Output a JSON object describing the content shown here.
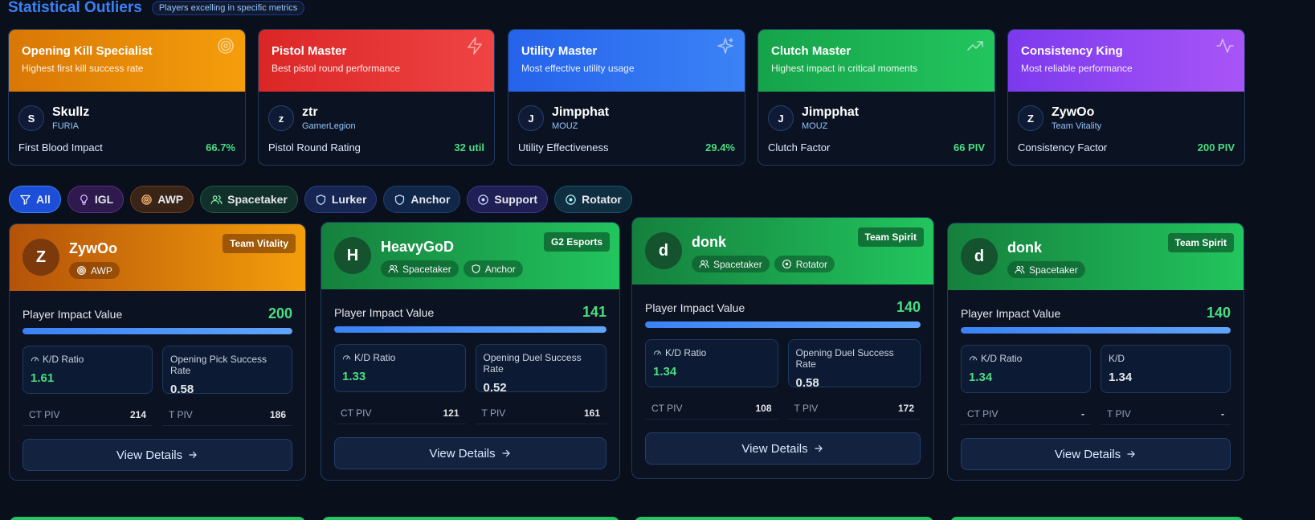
{
  "header": {
    "title": "Statistical Outliers",
    "subtitle": "Players excelling in specific metrics"
  },
  "outliers": [
    {
      "title": "Opening Kill Specialist",
      "desc": "Highest first kill success rate",
      "icon": "target-icon",
      "initial": "S",
      "player": "Skullz",
      "team": "FURIA",
      "metric": "First Blood Impact",
      "value": "66.7%",
      "gradient": [
        "#d97706",
        "#f59e0b"
      ]
    },
    {
      "title": "Pistol Master",
      "desc": "Best pistol round performance",
      "icon": "zap-icon",
      "initial": "z",
      "player": "ztr",
      "team": "GamerLegion",
      "metric": "Pistol Round Rating",
      "value": "32 util",
      "gradient": [
        "#dc2626",
        "#ef4444"
      ]
    },
    {
      "title": "Utility Master",
      "desc": "Most effective utility usage",
      "icon": "sparkles-icon",
      "initial": "J",
      "player": "Jimpphat",
      "team": "MOUZ",
      "metric": "Utility Effectiveness",
      "value": "29.4%",
      "gradient": [
        "#2563eb",
        "#3b82f6"
      ]
    },
    {
      "title": "Clutch Master",
      "desc": "Highest impact in critical moments",
      "icon": "trending-up-icon",
      "initial": "J",
      "player": "Jimpphat",
      "team": "MOUZ",
      "metric": "Clutch Factor",
      "value": "66 PIV",
      "gradient": [
        "#16a34a",
        "#22c55e"
      ]
    },
    {
      "title": "Consistency King",
      "desc": "Most reliable performance",
      "icon": "activity-icon",
      "initial": "Z",
      "player": "ZywOo",
      "team": "Team Vitality",
      "metric": "Consistency Factor",
      "value": "200 PIV",
      "gradient": [
        "#7c3aed",
        "#a855f7"
      ]
    }
  ],
  "filters": [
    {
      "label": "All",
      "icon": "filter-icon",
      "active": true
    },
    {
      "label": "IGL",
      "icon": "lightbulb-icon"
    },
    {
      "label": "AWP",
      "icon": "target-icon"
    },
    {
      "label": "Spacetaker",
      "icon": "users-icon"
    },
    {
      "label": "Lurker",
      "icon": "shield-icon"
    },
    {
      "label": "Anchor",
      "icon": "shield-icon"
    },
    {
      "label": "Support",
      "icon": "circle-dot-icon"
    },
    {
      "label": "Rotator",
      "icon": "circle-dot-icon"
    }
  ],
  "players": [
    {
      "initial": "Z",
      "name": "ZywOo",
      "team": "Team Vitality",
      "roles": [
        {
          "label": "AWP",
          "icon": "target-icon"
        }
      ],
      "piv_label": "Player Impact Value",
      "piv": "200",
      "piv_fraction": 1.0,
      "stat1_label": "K/D Ratio",
      "stat1_value": "1.61",
      "stat2_label": "Opening Pick Success Rate",
      "stat2_value": "0.58",
      "ct_label": "CT PIV",
      "ct_value": "214",
      "t_label": "T PIV",
      "t_value": "186",
      "button": "View Details",
      "theme": "orange"
    },
    {
      "initial": "H",
      "name": "HeavyGoD",
      "team": "G2 Esports",
      "roles": [
        {
          "label": "Spacetaker",
          "icon": "users-icon"
        },
        {
          "label": "Anchor",
          "icon": "shield-icon"
        }
      ],
      "piv_label": "Player Impact Value",
      "piv": "141",
      "piv_fraction": 1.0,
      "stat1_label": "K/D Ratio",
      "stat1_value": "1.33",
      "stat2_label": "Opening Duel Success Rate",
      "stat2_value": "0.52",
      "ct_label": "CT PIV",
      "ct_value": "121",
      "t_label": "T PIV",
      "t_value": "161",
      "button": "View Details",
      "theme": "green"
    },
    {
      "initial": "d",
      "name": "donk",
      "team": "Team Spirit",
      "roles": [
        {
          "label": "Spacetaker",
          "icon": "users-icon"
        },
        {
          "label": "Rotator",
          "icon": "circle-dot-icon"
        }
      ],
      "piv_label": "Player Impact Value",
      "piv": "140",
      "piv_fraction": 1.0,
      "stat1_label": "K/D Ratio",
      "stat1_value": "1.34",
      "stat2_label": "Opening Duel Success Rate",
      "stat2_value": "0.58",
      "ct_label": "CT PIV",
      "ct_value": "108",
      "t_label": "T PIV",
      "t_value": "172",
      "button": "View Details",
      "theme": "green"
    },
    {
      "initial": "d",
      "name": "donk",
      "team": "Team Spirit",
      "roles": [
        {
          "label": "Spacetaker",
          "icon": "users-icon"
        }
      ],
      "piv_label": "Player Impact Value",
      "piv": "140",
      "piv_fraction": 1.0,
      "stat1_label": "K/D Ratio",
      "stat1_value": "1.34",
      "stat2_label": "K/D",
      "stat2_value": "1.34",
      "ct_label": "CT PIV",
      "ct_value": "-",
      "t_label": "T PIV",
      "t_value": "-",
      "button": "View Details",
      "theme": "green"
    }
  ],
  "colors": {
    "accent": "#3b82f6",
    "positive": "#4ade80",
    "orange": [
      "#b45309",
      "#f59e0b"
    ],
    "green": [
      "#15803d",
      "#22c55e"
    ]
  }
}
